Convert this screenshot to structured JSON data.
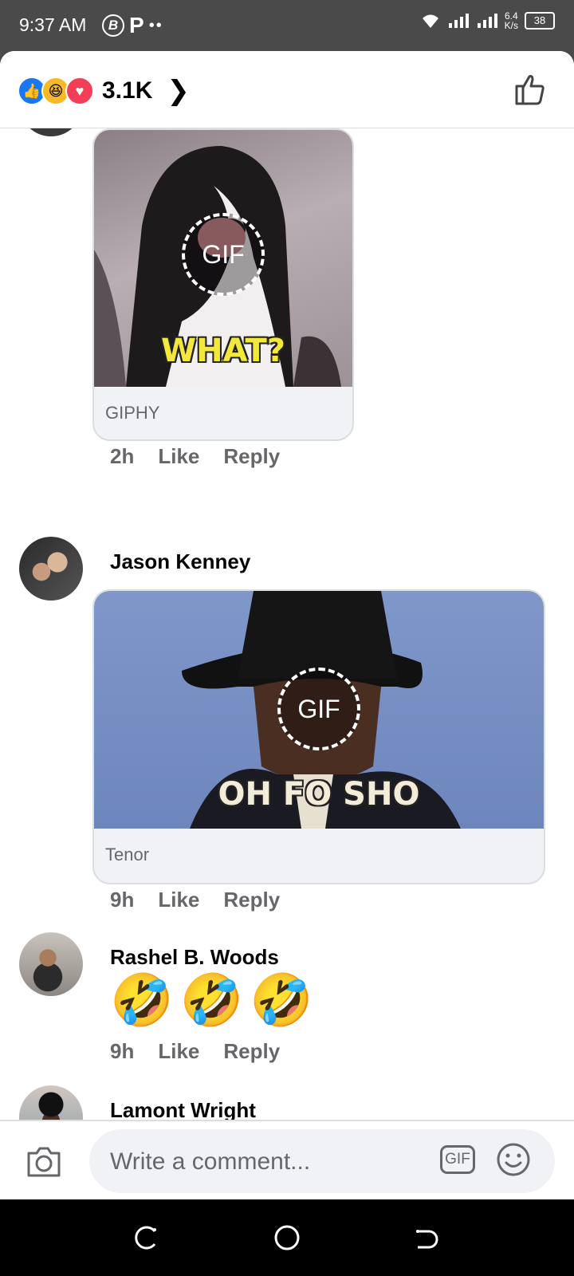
{
  "status_bar": {
    "time": "9:37 AM",
    "speed_value": "6.4",
    "speed_unit": "K/s",
    "battery": "38"
  },
  "header": {
    "reaction_count": "3.1K",
    "reaction_icons": [
      "like-icon",
      "haha-icon",
      "love-icon"
    ]
  },
  "comments": [
    {
      "name": "",
      "gif_caption": "WHAT?",
      "gif_badge": "GIF",
      "source": "GIPHY",
      "time": "2h",
      "like_label": "Like",
      "reply_label": "Reply"
    },
    {
      "name": "Jason Kenney",
      "gif_caption": "OH FO SHO",
      "gif_badge": "GIF",
      "source": "Tenor",
      "time": "9h",
      "like_label": "Like",
      "reply_label": "Reply"
    },
    {
      "name": "Rashel B. Woods",
      "emojis": [
        "🤣",
        "🤣",
        "🤣"
      ],
      "time": "9h",
      "like_label": "Like",
      "reply_label": "Reply"
    },
    {
      "name": "Lamont Wright"
    }
  ],
  "composer": {
    "placeholder": "Write a comment...",
    "gif_label": "GIF"
  },
  "colors": {
    "accent": "#1877f2",
    "text_secondary": "#65676b",
    "bubble": "#f0f2f5"
  }
}
